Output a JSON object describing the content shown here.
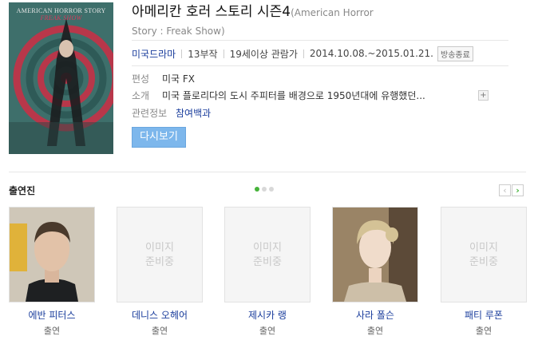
{
  "drama": {
    "poster_title": "AMERICAN HORROR STORY",
    "poster_subtitle": "FREAK SHOW",
    "title": "아메리칸 호러 스토리 시즌4",
    "title_eng_1": "(American Horror",
    "title_eng_2": "Story : Freak Show)",
    "genre": "미국드라마",
    "episodes": "13부작",
    "rating": "19세이상 관람가",
    "period": "2014.10.08.~2015.01.21.",
    "status_badge": "방송종료",
    "rows": [
      {
        "label": "편성",
        "value": "미국 FX"
      },
      {
        "label": "소개",
        "value": "미국 플로리다의 도시 주피터를 배경으로 1950년대에 유행했던..."
      },
      {
        "label": "관련정보",
        "value": "참여백과"
      }
    ],
    "more_symbol": "+",
    "watch_button": "다시보기"
  },
  "cast_section": {
    "title": "출연진",
    "prev": "‹",
    "next": "›",
    "placeholder": "이미지\n준비중",
    "items": [
      {
        "name": "에반 피터스",
        "role": "출연",
        "has_photo": true
      },
      {
        "name": "데니스 오헤어",
        "role": "출연",
        "has_photo": false
      },
      {
        "name": "제시카 랭",
        "role": "출연",
        "has_photo": false
      },
      {
        "name": "사라 폴슨",
        "role": "출연",
        "has_photo": true
      },
      {
        "name": "패티 루폰",
        "role": "출연",
        "has_photo": false
      }
    ]
  },
  "colors": {
    "link": "#1a3d9c",
    "button": "#7db7ec",
    "dot_active": "#46b33a"
  }
}
